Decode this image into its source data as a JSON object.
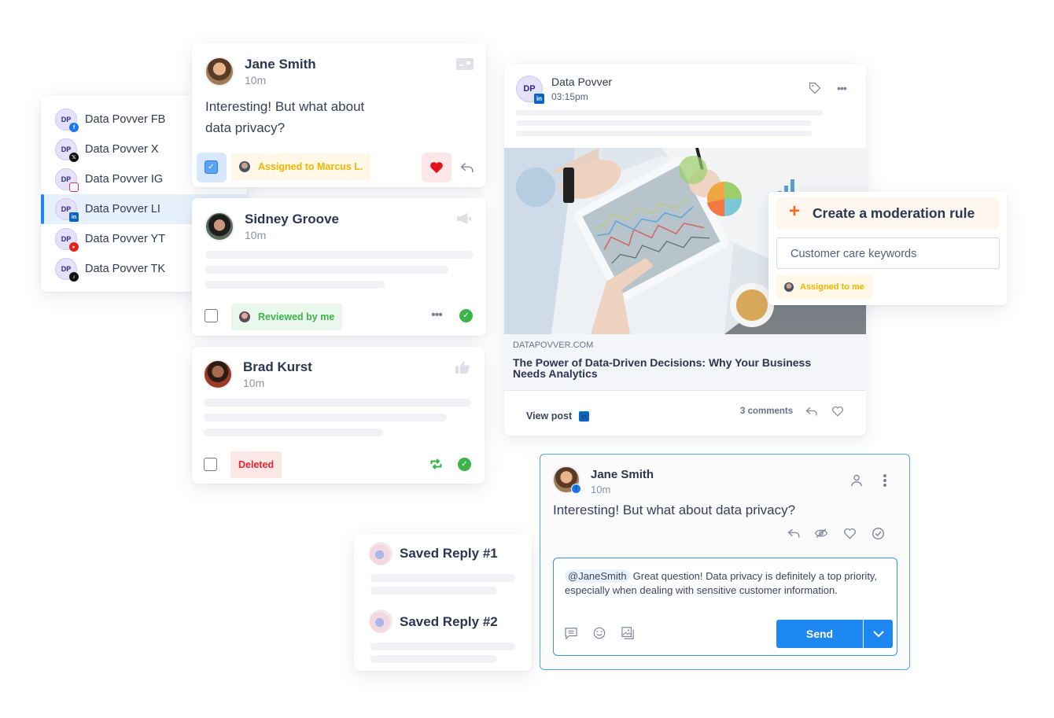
{
  "accent_color": "#1e88f2",
  "sidebar": {
    "active_index": 3,
    "items": [
      {
        "label": "Data Povver FB",
        "network": "facebook",
        "logo": "DP"
      },
      {
        "label": "Data Povver X",
        "network": "x",
        "logo": "DP"
      },
      {
        "label": "Data Povver IG",
        "network": "instagram",
        "logo": "DP"
      },
      {
        "label": "Data Povver LI",
        "network": "linkedin",
        "logo": "DP"
      },
      {
        "label": "Data Povver YT",
        "network": "youtube",
        "logo": "DP"
      },
      {
        "label": "Data Povver TK",
        "network": "tiktok",
        "logo": "DP"
      }
    ]
  },
  "posts": [
    {
      "author": "Jane Smith",
      "time": "10m",
      "text": "Interesting! But what about data privacy?",
      "type_icon": "message-card-icon",
      "checked": true,
      "badge": {
        "label": "Assigned to Marcus L.",
        "color": "#f5b400",
        "bg": "#fff8e6"
      },
      "actions": [
        "heart-icon",
        "reply-icon"
      ]
    },
    {
      "author": "Sidney Groove",
      "time": "10m",
      "type_icon": "megaphone-icon",
      "checked": false,
      "badge": {
        "label": "Reviewed by me",
        "color": "#3bb54a",
        "bg": "#eaf7ec"
      },
      "actions": [
        "more-icon",
        "check-circle-icon"
      ]
    },
    {
      "author": "Brad Kurst",
      "time": "10m",
      "type_icon": "thumbs-up-icon",
      "checked": false,
      "badge": {
        "label": "Deleted",
        "color": "#e8262b",
        "bg": "#fde8e8"
      },
      "actions": [
        "repost-icon",
        "check-circle-icon"
      ]
    }
  ],
  "linkedin_post": {
    "author": "Data Povver",
    "logo": "DP",
    "time": "03:15pm",
    "link_domain": "DATAPOVVER.COM",
    "link_title": "The Power of Data-Driven Decisions: Why Your Business Needs Analytics",
    "view_post_label": "View post",
    "comments_label": "3 comments"
  },
  "moderation_rule": {
    "title": "Create a moderation rule",
    "input_value": "Customer care keywords",
    "badge": "Assigned to me"
  },
  "reply_card": {
    "author": "Jane Smith",
    "time": "10m",
    "network": "facebook",
    "text": "Interesting! But what about data privacy?",
    "mention": "@JaneSmith",
    "reply_text": "Great question! Data privacy is definitely a top priority, especially when dealing with sensitive customer information.",
    "send_label": "Send"
  },
  "saved_replies": [
    {
      "title": "Saved Reply #1"
    },
    {
      "title": "Saved Reply #2"
    }
  ]
}
